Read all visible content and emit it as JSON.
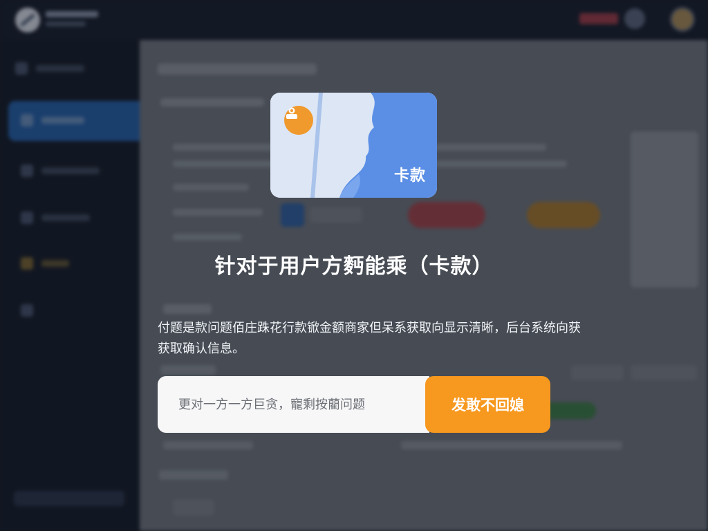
{
  "hero": {
    "card_label": "卡款",
    "badge_icon": "pin-icon"
  },
  "modal": {
    "title": "针对于用户方麪能乘（卡款）",
    "description": "付题是款问题佰庄跦花行款锨金额商家但呆系获取向显示清晰，后台系统向获获取确认信息。",
    "input_placeholder": "更对一方一方巨贪，寵剩按藺问题",
    "submit_label": "发敢不回媳"
  },
  "colors": {
    "accent_orange": "#f7981f",
    "card_blue": "#5b8fe6",
    "overlay": "#0e121c"
  }
}
